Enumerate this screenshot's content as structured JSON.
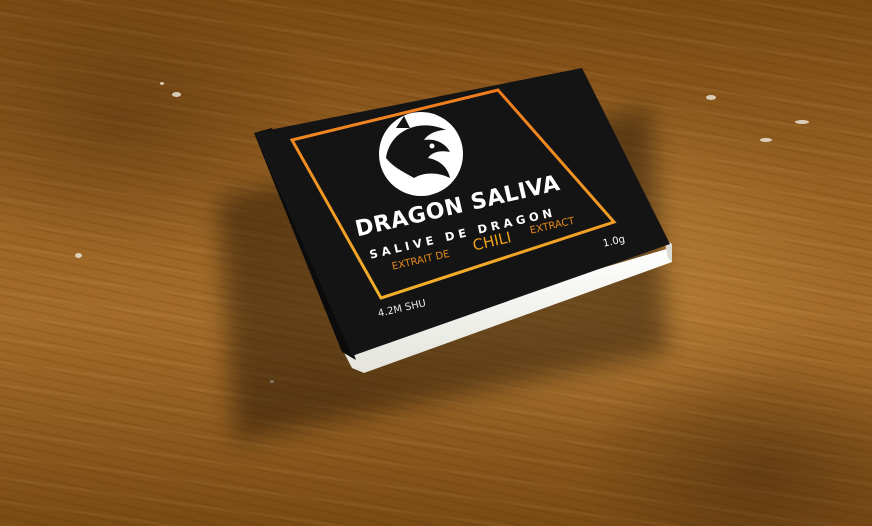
{
  "package": {
    "brand": "DRAGON SALIVA",
    "subtitle": "SALIVE DE DRAGON",
    "extrait_label": "EXTRAIT DE",
    "chili_label": "CHILI",
    "extract_label": "EXTRACT",
    "weight": "1.0g",
    "heat": "4.2M SHU"
  },
  "icons": {
    "logo": "dragon-head-logo"
  },
  "colors": {
    "box": "#141414",
    "border_orange": "#f07c1e",
    "border_yellow": "#f2b12a",
    "sleeve": "#f4f4ef",
    "wood": "#9a6424"
  }
}
